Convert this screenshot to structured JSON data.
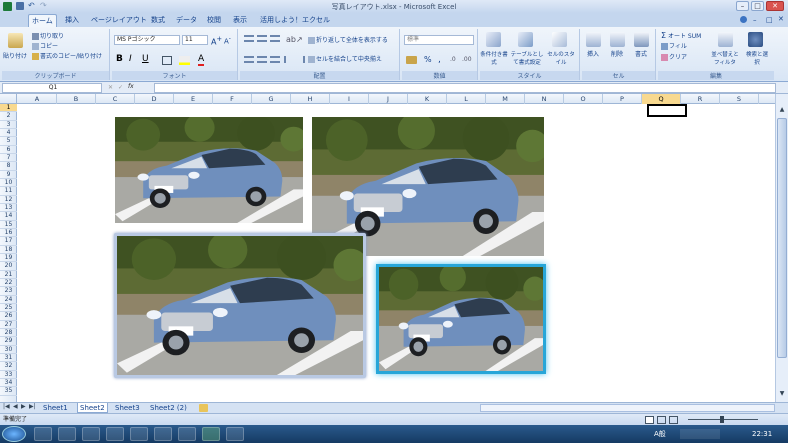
{
  "window": {
    "title": "写真レイアウト.xlsx - Microsoft Excel",
    "min_label": "–",
    "max_label": "□",
    "close_label": "✕"
  },
  "qat": {
    "save": "save-icon",
    "undo": "undo-icon",
    "redo": "redo-icon"
  },
  "tabs": [
    "ホーム",
    "挿入",
    "ページレイアウト",
    "数式",
    "データ",
    "校閲",
    "表示",
    "活用しよう！エクセル"
  ],
  "ribbon": {
    "clipboard": {
      "paste": "貼り付け",
      "cut": "切り取り",
      "copy": "コピー",
      "format_painter": "書式のコピー/貼り付け",
      "label": "クリップボード"
    },
    "font": {
      "name": "MS Pゴシック",
      "size": "11",
      "bold": "B",
      "italic": "I",
      "underline": "U",
      "label": "フォント"
    },
    "alignment": {
      "wrap": "折り返して全体を表示する",
      "merge": "セルを結合して中央揃え",
      "label": "配置"
    },
    "number": {
      "format": "標準",
      "percent": "%",
      "comma": ",",
      "label": "数値"
    },
    "styles": {
      "conditional": "条件付き書式",
      "table": "テーブルとして書式設定",
      "cell_styles": "セルのスタイル",
      "label": "スタイル"
    },
    "cells": {
      "insert": "挿入",
      "delete": "削除",
      "format": "書式",
      "label": "セル"
    },
    "editing": {
      "autosum": "オート SUM",
      "fill": "フィル",
      "clear": "クリア",
      "sort": "並べ替えとフィルタ",
      "find": "検索と選択",
      "label": "編集"
    }
  },
  "formula_bar": {
    "name_box": "Q1",
    "fx": "fx",
    "cancel": "✕",
    "enter": "✓",
    "value": ""
  },
  "columns": [
    "A",
    "B",
    "C",
    "D",
    "E",
    "F",
    "G",
    "H",
    "I",
    "J",
    "K",
    "L",
    "M",
    "N",
    "O",
    "P",
    "Q",
    "R",
    "S"
  ],
  "rows": [
    "1",
    "2",
    "3",
    "4",
    "5",
    "6",
    "7",
    "8",
    "9",
    "10",
    "11",
    "12",
    "13",
    "14",
    "15",
    "16",
    "17",
    "18",
    "19",
    "20",
    "21",
    "22",
    "23",
    "24",
    "25",
    "26",
    "27",
    "28",
    "29",
    "30",
    "31",
    "32",
    "33",
    "34",
    "35"
  ],
  "selected_cell": "Q1",
  "sheets": [
    "Sheet1",
    "Sheet2",
    "Sheet3",
    "Sheet2 (2)"
  ],
  "active_sheet": "Sheet2",
  "status": {
    "mode": "準備完了"
  },
  "taskbar": {
    "clock": "22:31",
    "ime": "A般"
  }
}
